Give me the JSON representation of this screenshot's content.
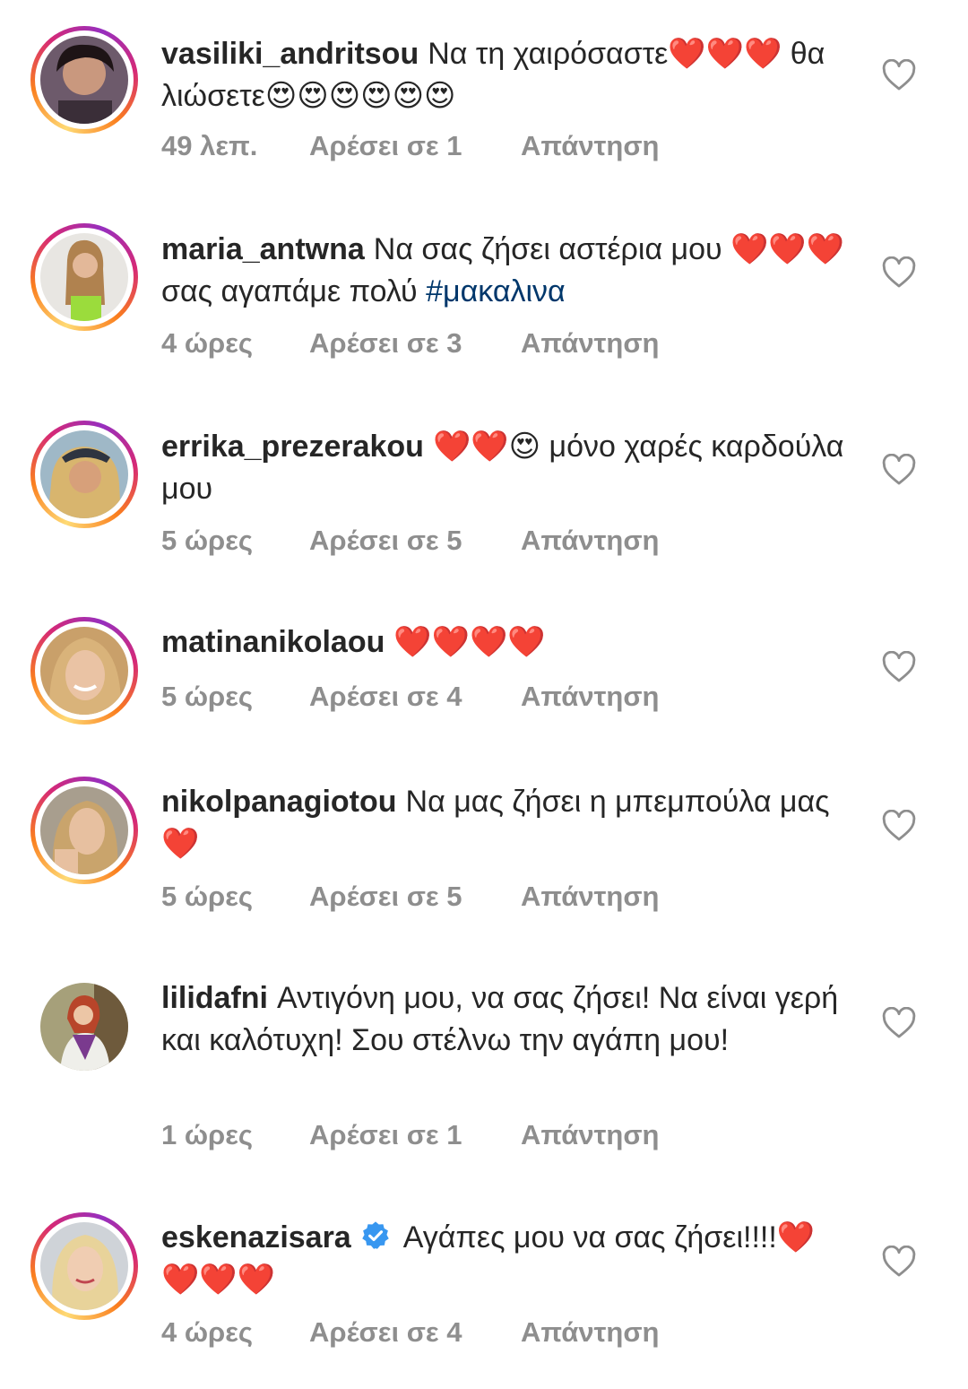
{
  "colors": {
    "text": "#262626",
    "meta": "#8e8e8e",
    "hashtag": "#00376b",
    "verified": "#3897f0"
  },
  "comments": [
    {
      "username": "vasiliki_andritsou",
      "text": "Να τη χαιρόσαστε❤️❤️❤️ θα λιώσετε😍😍😍😍😍😍",
      "time": "49 λεπ.",
      "likes": "Αρέσει σε 1",
      "reply": "Απάντηση"
    },
    {
      "username": "maria_antwna",
      "text": "Να σας ζήσει αστέρια μου ❤️❤️❤️ σας αγαπάμε πολύ",
      "hashtag": "#μακαλινα",
      "time": "4 ώρες",
      "likes": "Αρέσει σε 3",
      "reply": "Απάντηση"
    },
    {
      "username": "errika_prezerakou",
      "text": "❤️❤️😍 μόνο χαρές καρδούλα μου",
      "time": "5 ώρες",
      "likes": "Αρέσει σε 5",
      "reply": "Απάντηση"
    },
    {
      "username": "matinanikolaou",
      "text": "❤️❤️❤️❤️",
      "time": "5 ώρες",
      "likes": "Αρέσει σε 4",
      "reply": "Απάντηση"
    },
    {
      "username": "nikolpanagiotou",
      "text": "Να μας ζήσει η μπεμπούλα μας ❤️",
      "time": "5 ώρες",
      "likes": "Αρέσει σε 5",
      "reply": "Απάντηση"
    },
    {
      "username": "lilidafni",
      "text": "Αντιγόνη μου, να σας ζήσει! Να είναι γερή και καλότυχη! Σου στέλνω την αγάπη μου!",
      "time": "1 ώρες",
      "likes": "Αρέσει σε 1",
      "reply": "Απάντηση"
    },
    {
      "username": "eskenazisara",
      "verified": true,
      "text": "Αγάπες μου να σας ζήσει!!!!❤️❤️❤️❤️",
      "time": "4 ώρες",
      "likes": "Αρέσει σε 4",
      "reply": "Απάντηση"
    }
  ],
  "icons": {
    "like": "heart-outline-icon",
    "verified": "verified-badge-icon"
  }
}
